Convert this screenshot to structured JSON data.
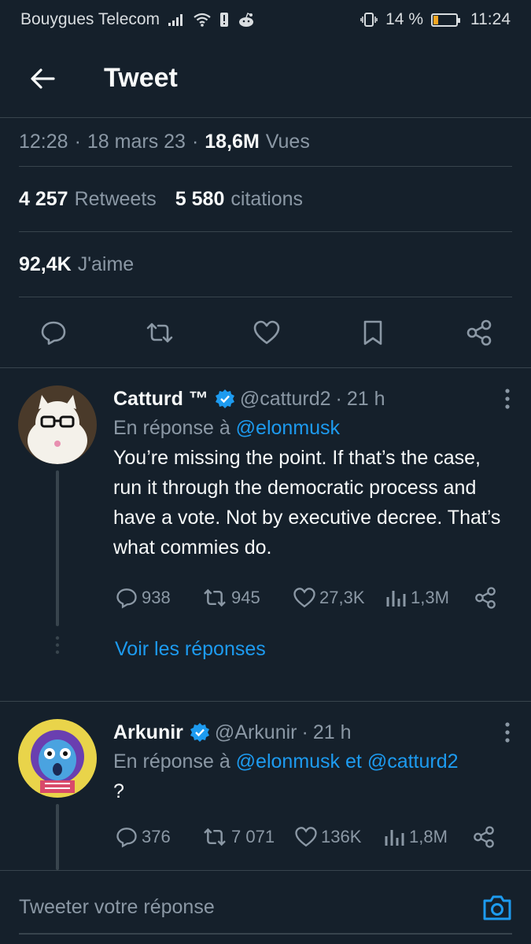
{
  "status_bar": {
    "carrier": "Bouygues Telecom",
    "battery_percent": "14 %",
    "time": "11:24"
  },
  "header": {
    "title": "Tweet",
    "back_icon": "arrow-left-icon"
  },
  "tweet_meta": {
    "time": "12:28",
    "date": "18 mars 23",
    "views_count": "18,6M",
    "views_label": "Vues",
    "retweets_count": "4 257",
    "retweets_label": "Retweets",
    "quotes_count": "5 580",
    "quotes_label": "citations",
    "likes_count": "92,4K",
    "likes_label": "J'aime"
  },
  "actions": [
    "reply-icon",
    "retweet-icon",
    "like-icon",
    "bookmark-icon",
    "share-icon"
  ],
  "replies": [
    {
      "name": "Catturd ™",
      "handle": "@catturd2",
      "time": "21 h",
      "replying_prefix": "En réponse à",
      "replying_to": "@elonmusk",
      "text": "You’re missing the point. If that’s the case, run it through the democratic process and have a vote. Not by executive decree. That’s what commies do.",
      "replies": "938",
      "retweets": "945",
      "likes": "27,3K",
      "views": "1,3M",
      "show_replies": "Voir les réponses"
    },
    {
      "name": "Arkunir",
      "handle": "@Arkunir",
      "time": "21 h",
      "replying_prefix": "En réponse à",
      "replying_to": "@elonmusk",
      "replying_joiner": "et",
      "replying_to_2": "@catturd2",
      "text": "?",
      "replies": "376",
      "retweets": "7 071",
      "likes": "136K",
      "views": "1,8M"
    }
  ],
  "composer": {
    "placeholder": "Tweeter votre réponse"
  },
  "colors": {
    "background": "#15202b",
    "accent": "#1d9bf0",
    "muted": "#8b98a5",
    "divider": "#38444d"
  }
}
